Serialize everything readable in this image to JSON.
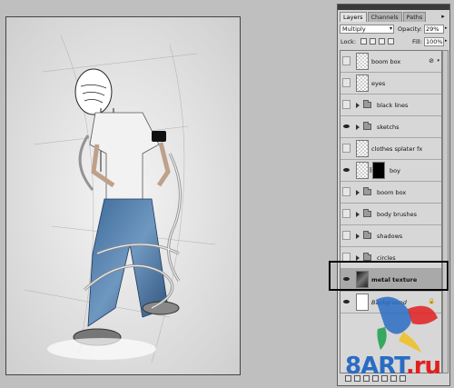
{
  "tabs": [
    "Layers",
    "Channels",
    "Paths"
  ],
  "panel_menu_icon": "panel-menu-icon",
  "blend_mode": "Multiply",
  "opacity_label": "Opacity:",
  "opacity_value": "29%",
  "lock_label": "Lock:",
  "fill_label": "Fill:",
  "fill_value": "100%",
  "layers": [
    {
      "name": "boom box",
      "type": "layer",
      "visible": false,
      "fx": true
    },
    {
      "name": "eyes",
      "type": "layer",
      "visible": false
    },
    {
      "name": "black lines",
      "type": "group",
      "visible": false
    },
    {
      "name": "sketchs",
      "type": "group",
      "visible": true
    },
    {
      "name": "clothes splater fx",
      "type": "layer",
      "visible": false
    },
    {
      "name": "boy",
      "type": "masked-layer",
      "visible": true
    },
    {
      "name": "boom box",
      "type": "group",
      "visible": false
    },
    {
      "name": "body brushes",
      "type": "group",
      "visible": false
    },
    {
      "name": "shadows",
      "type": "group",
      "visible": false
    },
    {
      "name": "circles",
      "type": "group",
      "visible": false
    },
    {
      "name": "metal texture",
      "type": "layer",
      "visible": true,
      "selected": true
    },
    {
      "name": "Background",
      "type": "background",
      "visible": true,
      "locked": true
    }
  ],
  "watermark": {
    "left": "8ART",
    "right": ".ru"
  },
  "colors": {
    "accent_blue": "#2a6cc3",
    "accent_red": "#e02020",
    "selection": "#a9a9a9"
  }
}
